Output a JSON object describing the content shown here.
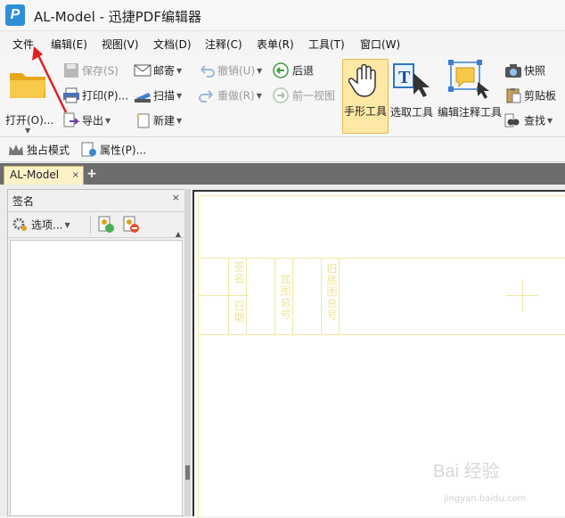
{
  "window": {
    "title": "AL-Model - 迅捷PDF编辑器"
  },
  "menu": [
    "文件",
    "编辑(E)",
    "视图(V)",
    "文档(D)",
    "注释(C)",
    "表单(R)",
    "工具(T)",
    "窗口(W)"
  ],
  "ribbon": {
    "open": "打开(O)...",
    "save": "保存(S)",
    "print": "打印(P)...",
    "export": "导出",
    "mail": "邮寄",
    "scan": "扫描",
    "new": "新建",
    "undo": "撤销(U)",
    "redo": "重做(R)",
    "back": "后退",
    "forward": "前一视图",
    "hand": "手形工具",
    "select": "选取工具",
    "edit_annot": "编辑注释工具",
    "snapshot": "快照",
    "clipboard": "剪贴板",
    "find": "查找"
  },
  "modebar": {
    "exclusive": "独占模式",
    "properties": "属性(P)..."
  },
  "tabs": {
    "doc": "AL-Model",
    "add": "+",
    "close": "×"
  },
  "panel": {
    "title": "签名",
    "close": "×",
    "options": "选项..."
  },
  "drawing": {
    "label1": "签名",
    "label2": "日期",
    "label3": "底图总号",
    "label4": "旧底图总号"
  },
  "watermark": {
    "main": "Bai 经验",
    "url": "jingyan.baidu.com"
  }
}
